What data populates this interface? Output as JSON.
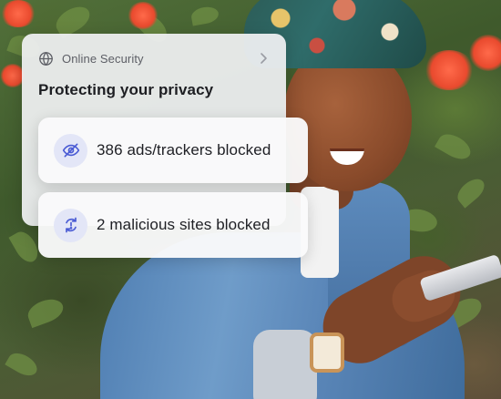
{
  "card": {
    "header_label": "Online Security",
    "title": "Protecting your privacy",
    "stats": [
      {
        "label": "386 ads/trackers blocked",
        "icon": "eye-off-icon"
      },
      {
        "label": "2 malicious sites blocked",
        "icon": "shield-refresh-icon"
      }
    ]
  },
  "colors": {
    "accent_icon": "#4a5bd4",
    "icon_bg": "#e3e6f7",
    "card_bg": "#f0f1f3"
  }
}
